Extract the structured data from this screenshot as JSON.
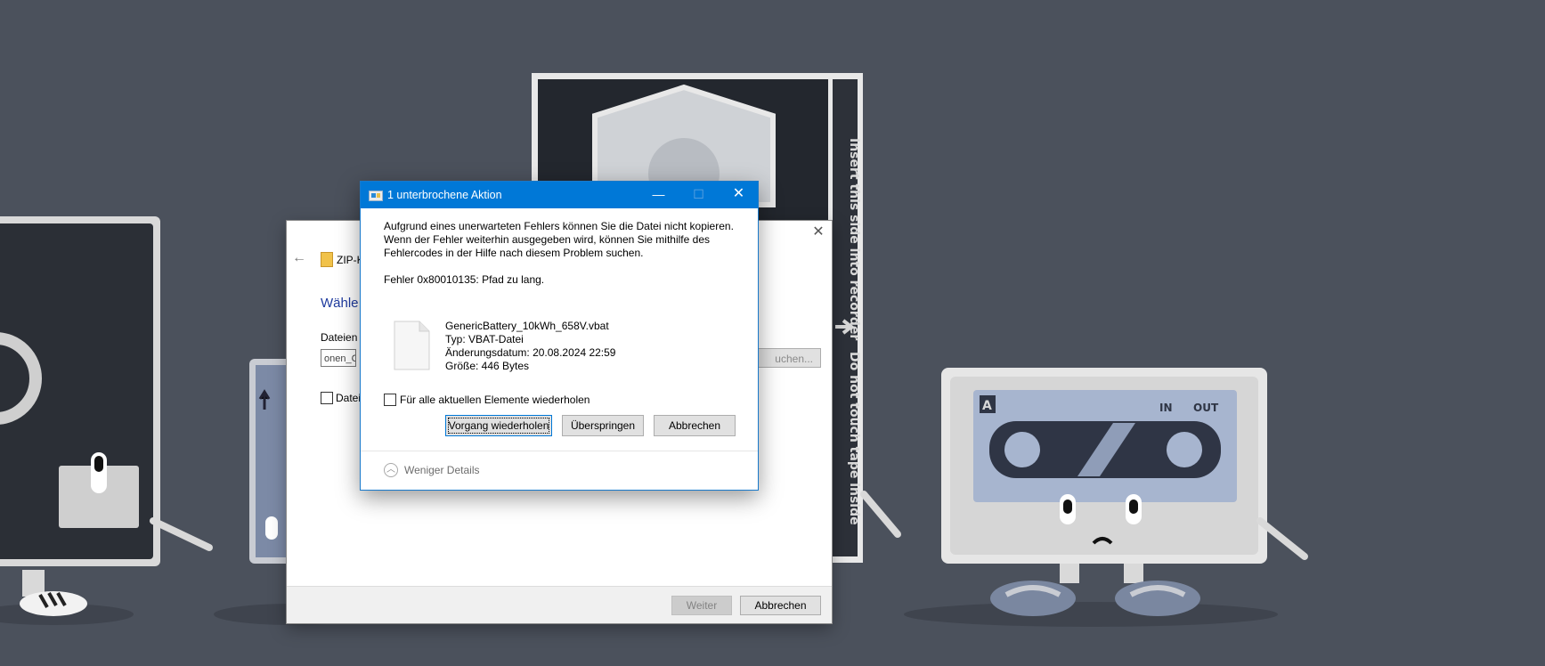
{
  "wallpaper": {
    "tape_side_text_1": "Insert this side into recorder",
    "tape_side_text_2": "Do not touch tape inside",
    "cassette_label_letter": "A",
    "cassette_in": "IN",
    "cassette_out": "OUT"
  },
  "wizard": {
    "breadcrumb": "ZIP-K",
    "heading": "Wähle",
    "files_label": "Dateien",
    "path_value": "onen_C",
    "browse_label": "uchen...",
    "checkbox_label": "Datei",
    "next_label": "Weiter",
    "cancel_label": "Abbrechen"
  },
  "dialog": {
    "title": "1 unterbrochene Aktion",
    "message": "Aufgrund eines unerwarteten Fehlers können Sie die Datei nicht kopieren. Wenn der Fehler weiterhin ausgegeben wird, können Sie mithilfe des Fehlercodes in der Hilfe nach diesem Problem suchen.",
    "error": "Fehler 0x80010135: Pfad zu lang.",
    "file": {
      "name": "GenericBattery_10kWh_658V.vbat",
      "type": "Typ: VBAT-Datei",
      "modified": "Änderungsdatum: 20.08.2024 22:59",
      "size": "Größe: 446 Bytes"
    },
    "repeat_label": "Für alle aktuellen Elemente wiederholen",
    "retry_label": "Vorgang wiederholen",
    "skip_label": "Überspringen",
    "cancel_label": "Abbrechen",
    "details_label": "Weniger Details"
  }
}
